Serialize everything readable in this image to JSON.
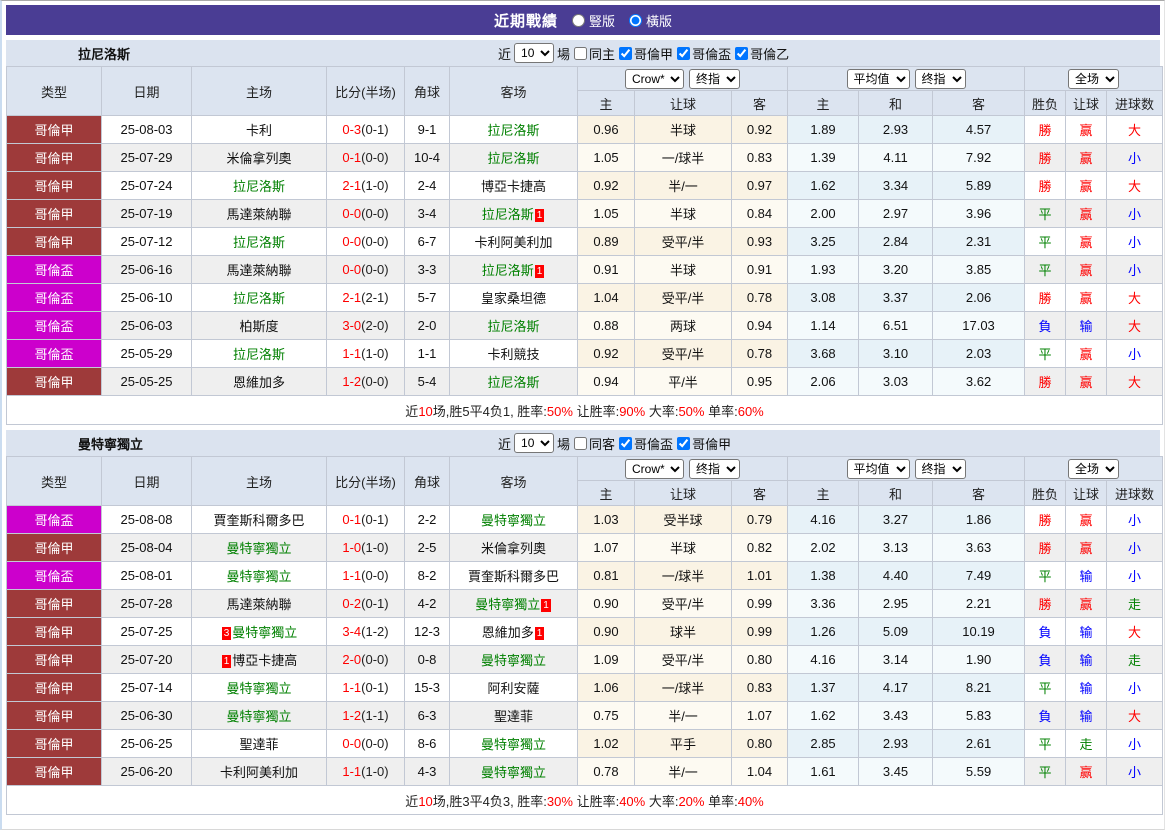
{
  "colors": {
    "topbar_bg": "#4a3d94",
    "section_bar_bg": "#dbe3ef",
    "header_bg": "#dce4f0",
    "league_jia_bg": "#9e3a3a",
    "league_bei_bg": "#cc00cc",
    "win_red": "#ff0000",
    "lose_blue": "#0000ff",
    "draw_green": "#008000",
    "asia_col_bg": "#faf3e4",
    "euro_col_bg": "#e7f2f8",
    "alt_row_bg": "#efefef"
  },
  "titlebar": {
    "title": "近期戰績",
    "radios": [
      {
        "label": "豎版",
        "selected": false
      },
      {
        "label": "橫版",
        "selected": true
      }
    ]
  },
  "controls": {
    "near": "近",
    "games": "10",
    "unit": "場"
  },
  "table_header": {
    "left_cols": [
      "类型",
      "日期",
      "主场",
      "比分(半场)",
      "角球",
      "客场"
    ],
    "asia_selects": [
      "Crow*",
      "终指"
    ],
    "asia_cols": [
      "主",
      "让球",
      "客"
    ],
    "euro_selects": [
      "平均值",
      "终指"
    ],
    "euro_cols": [
      "主",
      "和",
      "客"
    ],
    "result_select": "全场",
    "result_cols": [
      "胜负",
      "让球",
      "进球数"
    ]
  },
  "sections": [
    {
      "team": "拉尼洛斯",
      "same_filter": {
        "label": "同主",
        "checked": false
      },
      "league_filters": [
        {
          "label": "哥倫甲",
          "checked": true
        },
        {
          "label": "哥倫盃",
          "checked": true
        },
        {
          "label": "哥倫乙",
          "checked": true
        }
      ],
      "rows": [
        {
          "league": "哥倫甲",
          "league_type": "jia",
          "date": "25-08-03",
          "home": {
            "name": "卡利",
            "green": false
          },
          "score_ft": "0-3",
          "score_ht": "(0-1)",
          "corners": "9-1",
          "away": {
            "name": "拉尼洛斯",
            "green": true
          },
          "asia": [
            "0.96",
            "半球",
            "0.92"
          ],
          "euro": [
            "1.89",
            "2.93",
            "4.57"
          ],
          "results": [
            {
              "t": "勝",
              "c": "red"
            },
            {
              "t": "赢",
              "c": "red"
            },
            {
              "t": "大",
              "c": "red"
            }
          ]
        },
        {
          "league": "哥倫甲",
          "league_type": "jia",
          "date": "25-07-29",
          "home": {
            "name": "米倫拿列奧",
            "green": false
          },
          "score_ft": "0-1",
          "score_ht": "(0-0)",
          "corners": "10-4",
          "away": {
            "name": "拉尼洛斯",
            "green": true
          },
          "asia": [
            "1.05",
            "一/球半",
            "0.83"
          ],
          "euro": [
            "1.39",
            "4.11",
            "7.92"
          ],
          "results": [
            {
              "t": "勝",
              "c": "red"
            },
            {
              "t": "赢",
              "c": "red"
            },
            {
              "t": "小",
              "c": "blue"
            }
          ]
        },
        {
          "league": "哥倫甲",
          "league_type": "jia",
          "date": "25-07-24",
          "home": {
            "name": "拉尼洛斯",
            "green": true
          },
          "score_ft": "2-1",
          "score_ht": "(1-0)",
          "corners": "2-4",
          "away": {
            "name": "博亞卡捷高",
            "green": false
          },
          "asia": [
            "0.92",
            "半/一",
            "0.97"
          ],
          "euro": [
            "1.62",
            "3.34",
            "5.89"
          ],
          "results": [
            {
              "t": "勝",
              "c": "red"
            },
            {
              "t": "赢",
              "c": "red"
            },
            {
              "t": "大",
              "c": "red"
            }
          ]
        },
        {
          "league": "哥倫甲",
          "league_type": "jia",
          "date": "25-07-19",
          "home": {
            "name": "馬達萊納聯",
            "green": false
          },
          "score_ft": "0-0",
          "score_ht": "(0-0)",
          "corners": "3-4",
          "away": {
            "name": "拉尼洛斯",
            "green": true,
            "badge_after": "1"
          },
          "asia": [
            "1.05",
            "半球",
            "0.84"
          ],
          "euro": [
            "2.00",
            "2.97",
            "3.96"
          ],
          "results": [
            {
              "t": "平",
              "c": "grn"
            },
            {
              "t": "赢",
              "c": "red"
            },
            {
              "t": "小",
              "c": "blue"
            }
          ]
        },
        {
          "league": "哥倫甲",
          "league_type": "jia",
          "date": "25-07-12",
          "home": {
            "name": "拉尼洛斯",
            "green": true
          },
          "score_ft": "0-0",
          "score_ht": "(0-0)",
          "corners": "6-7",
          "away": {
            "name": "卡利阿美利加",
            "green": false
          },
          "asia": [
            "0.89",
            "受平/半",
            "0.93"
          ],
          "euro": [
            "3.25",
            "2.84",
            "2.31"
          ],
          "results": [
            {
              "t": "平",
              "c": "grn"
            },
            {
              "t": "赢",
              "c": "red"
            },
            {
              "t": "小",
              "c": "blue"
            }
          ]
        },
        {
          "league": "哥倫盃",
          "league_type": "bei",
          "date": "25-06-16",
          "home": {
            "name": "馬達萊納聯",
            "green": false
          },
          "score_ft": "0-0",
          "score_ht": "(0-0)",
          "corners": "3-3",
          "away": {
            "name": "拉尼洛斯",
            "green": true,
            "badge_after": "1"
          },
          "asia": [
            "0.91",
            "半球",
            "0.91"
          ],
          "euro": [
            "1.93",
            "3.20",
            "3.85"
          ],
          "results": [
            {
              "t": "平",
              "c": "grn"
            },
            {
              "t": "赢",
              "c": "red"
            },
            {
              "t": "小",
              "c": "blue"
            }
          ]
        },
        {
          "league": "哥倫盃",
          "league_type": "bei",
          "date": "25-06-10",
          "home": {
            "name": "拉尼洛斯",
            "green": true
          },
          "score_ft": "2-1",
          "score_ht": "(2-1)",
          "corners": "5-7",
          "away": {
            "name": "皇家桑坦德",
            "green": false
          },
          "asia": [
            "1.04",
            "受平/半",
            "0.78"
          ],
          "euro": [
            "3.08",
            "3.37",
            "2.06"
          ],
          "results": [
            {
              "t": "勝",
              "c": "red"
            },
            {
              "t": "赢",
              "c": "red"
            },
            {
              "t": "大",
              "c": "red"
            }
          ]
        },
        {
          "league": "哥倫盃",
          "league_type": "bei",
          "date": "25-06-03",
          "home": {
            "name": "柏斯度",
            "green": false
          },
          "score_ft": "3-0",
          "score_ht": "(2-0)",
          "corners": "2-0",
          "away": {
            "name": "拉尼洛斯",
            "green": true
          },
          "asia": [
            "0.88",
            "两球",
            "0.94"
          ],
          "euro": [
            "1.14",
            "6.51",
            "17.03"
          ],
          "results": [
            {
              "t": "負",
              "c": "blue"
            },
            {
              "t": "输",
              "c": "blue"
            },
            {
              "t": "大",
              "c": "red"
            }
          ]
        },
        {
          "league": "哥倫盃",
          "league_type": "bei",
          "date": "25-05-29",
          "home": {
            "name": "拉尼洛斯",
            "green": true
          },
          "score_ft": "1-1",
          "score_ht": "(1-0)",
          "corners": "1-1",
          "away": {
            "name": "卡利競技",
            "green": false
          },
          "asia": [
            "0.92",
            "受平/半",
            "0.78"
          ],
          "euro": [
            "3.68",
            "3.10",
            "2.03"
          ],
          "results": [
            {
              "t": "平",
              "c": "grn"
            },
            {
              "t": "赢",
              "c": "red"
            },
            {
              "t": "小",
              "c": "blue"
            }
          ]
        },
        {
          "league": "哥倫甲",
          "league_type": "jia",
          "date": "25-05-25",
          "home": {
            "name": "恩維加多",
            "green": false
          },
          "score_ft": "1-2",
          "score_ht": "(0-0)",
          "corners": "5-4",
          "away": {
            "name": "拉尼洛斯",
            "green": true
          },
          "asia": [
            "0.94",
            "平/半",
            "0.95"
          ],
          "euro": [
            "2.06",
            "3.03",
            "3.62"
          ],
          "results": [
            {
              "t": "勝",
              "c": "red"
            },
            {
              "t": "赢",
              "c": "red"
            },
            {
              "t": "大",
              "c": "red"
            }
          ]
        }
      ],
      "summary": [
        {
          "t": "近",
          "r": false
        },
        {
          "t": "10",
          "r": true
        },
        {
          "t": "场,胜5平4负1, 胜率:",
          "r": false
        },
        {
          "t": "50%",
          "r": true
        },
        {
          "t": " 让胜率:",
          "r": false
        },
        {
          "t": "90%",
          "r": true
        },
        {
          "t": " 大率:",
          "r": false
        },
        {
          "t": "50%",
          "r": true
        },
        {
          "t": " 单率:",
          "r": false
        },
        {
          "t": "60%",
          "r": true
        }
      ]
    },
    {
      "team": "曼特寧獨立",
      "same_filter": {
        "label": "同客",
        "checked": false
      },
      "league_filters": [
        {
          "label": "哥倫盃",
          "checked": true
        },
        {
          "label": "哥倫甲",
          "checked": true
        }
      ],
      "rows": [
        {
          "league": "哥倫盃",
          "league_type": "bei",
          "date": "25-08-08",
          "home": {
            "name": "賈奎斯科爾多巴",
            "green": false
          },
          "score_ft": "0-1",
          "score_ht": "(0-1)",
          "corners": "2-2",
          "away": {
            "name": "曼特寧獨立",
            "green": true
          },
          "asia": [
            "1.03",
            "受半球",
            "0.79"
          ],
          "euro": [
            "4.16",
            "3.27",
            "1.86"
          ],
          "results": [
            {
              "t": "勝",
              "c": "red"
            },
            {
              "t": "赢",
              "c": "red"
            },
            {
              "t": "小",
              "c": "blue"
            }
          ]
        },
        {
          "league": "哥倫甲",
          "league_type": "jia",
          "date": "25-08-04",
          "home": {
            "name": "曼特寧獨立",
            "green": true
          },
          "score_ft": "1-0",
          "score_ht": "(1-0)",
          "corners": "2-5",
          "away": {
            "name": "米倫拿列奧",
            "green": false
          },
          "asia": [
            "1.07",
            "半球",
            "0.82"
          ],
          "euro": [
            "2.02",
            "3.13",
            "3.63"
          ],
          "results": [
            {
              "t": "勝",
              "c": "red"
            },
            {
              "t": "赢",
              "c": "red"
            },
            {
              "t": "小",
              "c": "blue"
            }
          ]
        },
        {
          "league": "哥倫盃",
          "league_type": "bei",
          "date": "25-08-01",
          "home": {
            "name": "曼特寧獨立",
            "green": true
          },
          "score_ft": "1-1",
          "score_ht": "(0-0)",
          "corners": "8-2",
          "away": {
            "name": "賈奎斯科爾多巴",
            "green": false
          },
          "asia": [
            "0.81",
            "一/球半",
            "1.01"
          ],
          "euro": [
            "1.38",
            "4.40",
            "7.49"
          ],
          "results": [
            {
              "t": "平",
              "c": "grn"
            },
            {
              "t": "输",
              "c": "blue"
            },
            {
              "t": "小",
              "c": "blue"
            }
          ]
        },
        {
          "league": "哥倫甲",
          "league_type": "jia",
          "date": "25-07-28",
          "home": {
            "name": "馬達萊納聯",
            "green": false
          },
          "score_ft": "0-2",
          "score_ht": "(0-1)",
          "corners": "4-2",
          "away": {
            "name": "曼特寧獨立",
            "green": true,
            "badge_after": "1"
          },
          "asia": [
            "0.90",
            "受平/半",
            "0.99"
          ],
          "euro": [
            "3.36",
            "2.95",
            "2.21"
          ],
          "results": [
            {
              "t": "勝",
              "c": "red"
            },
            {
              "t": "赢",
              "c": "red"
            },
            {
              "t": "走",
              "c": "grn"
            }
          ]
        },
        {
          "league": "哥倫甲",
          "league_type": "jia",
          "date": "25-07-25",
          "home": {
            "name": "曼特寧獨立",
            "green": true,
            "badge_before": "3"
          },
          "score_ft": "3-4",
          "score_ht": "(1-2)",
          "corners": "12-3",
          "away": {
            "name": "恩維加多",
            "green": false,
            "badge_after": "1"
          },
          "asia": [
            "0.90",
            "球半",
            "0.99"
          ],
          "euro": [
            "1.26",
            "5.09",
            "10.19"
          ],
          "results": [
            {
              "t": "負",
              "c": "blue"
            },
            {
              "t": "输",
              "c": "blue"
            },
            {
              "t": "大",
              "c": "red"
            }
          ]
        },
        {
          "league": "哥倫甲",
          "league_type": "jia",
          "date": "25-07-20",
          "home": {
            "name": "博亞卡捷高",
            "green": false,
            "badge_before": "1"
          },
          "score_ft": "2-0",
          "score_ht": "(0-0)",
          "corners": "0-8",
          "away": {
            "name": "曼特寧獨立",
            "green": true
          },
          "asia": [
            "1.09",
            "受平/半",
            "0.80"
          ],
          "euro": [
            "4.16",
            "3.14",
            "1.90"
          ],
          "results": [
            {
              "t": "負",
              "c": "blue"
            },
            {
              "t": "输",
              "c": "blue"
            },
            {
              "t": "走",
              "c": "grn"
            }
          ]
        },
        {
          "league": "哥倫甲",
          "league_type": "jia",
          "date": "25-07-14",
          "home": {
            "name": "曼特寧獨立",
            "green": true
          },
          "score_ft": "1-1",
          "score_ht": "(0-1)",
          "corners": "15-3",
          "away": {
            "name": "阿利安薩",
            "green": false
          },
          "asia": [
            "1.06",
            "一/球半",
            "0.83"
          ],
          "euro": [
            "1.37",
            "4.17",
            "8.21"
          ],
          "results": [
            {
              "t": "平",
              "c": "grn"
            },
            {
              "t": "输",
              "c": "blue"
            },
            {
              "t": "小",
              "c": "blue"
            }
          ]
        },
        {
          "league": "哥倫甲",
          "league_type": "jia",
          "date": "25-06-30",
          "home": {
            "name": "曼特寧獨立",
            "green": true
          },
          "score_ft": "1-2",
          "score_ht": "(1-1)",
          "corners": "6-3",
          "away": {
            "name": "聖達菲",
            "green": false
          },
          "asia": [
            "0.75",
            "半/一",
            "1.07"
          ],
          "euro": [
            "1.62",
            "3.43",
            "5.83"
          ],
          "results": [
            {
              "t": "負",
              "c": "blue"
            },
            {
              "t": "输",
              "c": "blue"
            },
            {
              "t": "大",
              "c": "red"
            }
          ]
        },
        {
          "league": "哥倫甲",
          "league_type": "jia",
          "date": "25-06-25",
          "home": {
            "name": "聖達菲",
            "green": false
          },
          "score_ft": "0-0",
          "score_ht": "(0-0)",
          "corners": "8-6",
          "away": {
            "name": "曼特寧獨立",
            "green": true
          },
          "asia": [
            "1.02",
            "平手",
            "0.80"
          ],
          "euro": [
            "2.85",
            "2.93",
            "2.61"
          ],
          "results": [
            {
              "t": "平",
              "c": "grn"
            },
            {
              "t": "走",
              "c": "grn"
            },
            {
              "t": "小",
              "c": "blue"
            }
          ]
        },
        {
          "league": "哥倫甲",
          "league_type": "jia",
          "date": "25-06-20",
          "home": {
            "name": "卡利阿美利加",
            "green": false
          },
          "score_ft": "1-1",
          "score_ht": "(1-0)",
          "corners": "4-3",
          "away": {
            "name": "曼特寧獨立",
            "green": true
          },
          "asia": [
            "0.78",
            "半/一",
            "1.04"
          ],
          "euro": [
            "1.61",
            "3.45",
            "5.59"
          ],
          "results": [
            {
              "t": "平",
              "c": "grn"
            },
            {
              "t": "赢",
              "c": "red"
            },
            {
              "t": "小",
              "c": "blue"
            }
          ]
        }
      ],
      "summary": [
        {
          "t": "近",
          "r": false
        },
        {
          "t": "10",
          "r": true
        },
        {
          "t": "场,胜3平4负3, 胜率:",
          "r": false
        },
        {
          "t": "30%",
          "r": true
        },
        {
          "t": " 让胜率:",
          "r": false
        },
        {
          "t": "40%",
          "r": true
        },
        {
          "t": " 大率:",
          "r": false
        },
        {
          "t": "20%",
          "r": true
        },
        {
          "t": " 单率:",
          "r": false
        },
        {
          "t": "40%",
          "r": true
        }
      ]
    }
  ]
}
